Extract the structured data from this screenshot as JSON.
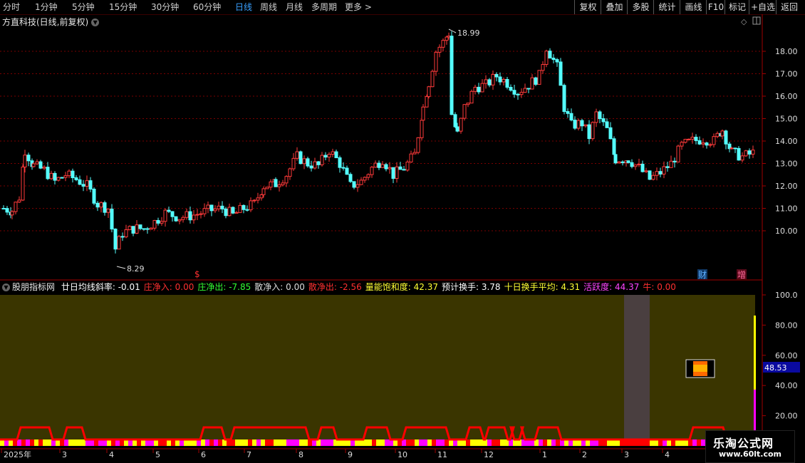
{
  "toolbar": {
    "periods": [
      "分时",
      "1分钟",
      "5分钟",
      "15分钟",
      "30分钟",
      "60分钟",
      "日线",
      "周线",
      "月线",
      "多周期",
      "更多 >"
    ],
    "active_period": "日线",
    "right_buttons": [
      "复权",
      "叠加",
      "多股",
      "统计",
      "画线",
      "F10",
      "标记",
      "+自选",
      "返回"
    ]
  },
  "main_chart": {
    "title": "方直科技(日线,前复权)",
    "price_ticks": [
      "18.00",
      "17.00",
      "16.00",
      "15.00",
      "14.00",
      "13.00",
      "12.00",
      "11.00",
      "10.00"
    ],
    "high_label": "18.99",
    "low_label": "8.29",
    "markers": [
      "$",
      "财",
      "增"
    ]
  },
  "indicator": {
    "name": "股朋指标网",
    "items": [
      {
        "label": "廿日均线斜率:",
        "value": "-0.01",
        "color": "#ffffff"
      },
      {
        "label": "庄净入:",
        "value": "0.00",
        "color": "#ff3030"
      },
      {
        "label": "庄净出:",
        "value": "-7.85",
        "color": "#33ff33"
      },
      {
        "label": "散净入:",
        "value": "0.00",
        "color": "#dddddd"
      },
      {
        "label": "散净出:",
        "value": "-2.56",
        "color": "#ff3030"
      },
      {
        "label": "量能饱和度:",
        "value": "42.37",
        "color": "#ffff33"
      },
      {
        "label": "预计换手:",
        "value": "3.78",
        "color": "#ffffff"
      },
      {
        "label": "十日换手平均:",
        "value": "4.31",
        "color": "#ffff33"
      },
      {
        "label": "活跃度:",
        "value": "44.37",
        "color": "#ff44ff"
      },
      {
        "label": "牛:",
        "value": "0.00",
        "color": "#ff3030"
      }
    ],
    "ticks": [
      "100.0",
      "80.00",
      "60.00",
      "40.00",
      "20.00"
    ],
    "current_value": "48.53"
  },
  "time_axis": [
    "2025年",
    "3",
    "4",
    "5",
    "6",
    "7",
    "8",
    "9",
    "10",
    "11",
    "12",
    "1",
    "2",
    "3",
    "4"
  ],
  "watermark": {
    "title": "乐淘公式网",
    "url": "www.60lt.com"
  }
}
